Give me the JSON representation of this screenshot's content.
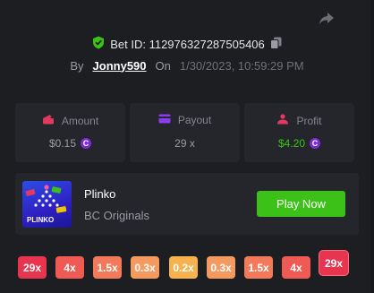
{
  "bet": {
    "id_label": "Bet ID: 112976327287505406",
    "by_label": "By",
    "username": "Jonny590",
    "on_label": "On",
    "datetime": "1/30/2023, 10:59:29 PM"
  },
  "stats": {
    "amount": {
      "label": "Amount",
      "value": "$0.15",
      "icon": "wallet-icon"
    },
    "payout": {
      "label": "Payout",
      "value": "29 x",
      "icon": "card-icon"
    },
    "profit": {
      "label": "Profit",
      "value": "$4.20",
      "icon": "profit-icon"
    }
  },
  "coin_symbol": "C",
  "game": {
    "name": "Plinko",
    "provider": "BC Originals",
    "thumbnail_text": "PLINKO",
    "play_label": "Play Now"
  },
  "multipliers": [
    "29x",
    "4x",
    "1.5x",
    "0.3x",
    "0.2x",
    "0.3x",
    "1.5x",
    "4x",
    "29x"
  ],
  "highlighted_multiplier_index": 8,
  "colors": {
    "background": "#1c1e22",
    "card": "#24262b",
    "accent_green": "#3bc117",
    "profit_green": "#3bc117",
    "shield_green": "#3bc117",
    "coin_purple": "#7b2cd9",
    "amount_icon": "#e23a5e",
    "payout_icon": "#8b3cf0",
    "profit_icon": "#e23a5e"
  }
}
